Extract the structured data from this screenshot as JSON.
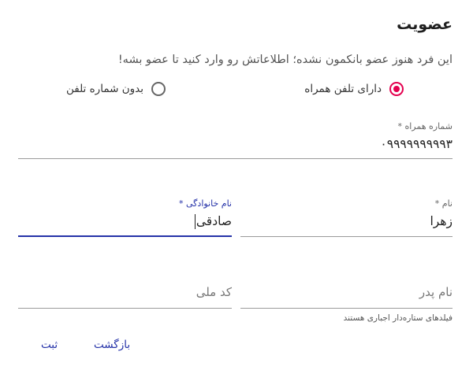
{
  "dialog": {
    "title": "عضویت",
    "intro": "این فرد هنوز عضو بانکمون نشده؛ اطلاعاتش رو وارد کنید تا عضو بشه!"
  },
  "phone_option": {
    "options": [
      {
        "label": "دارای تلفن همراه",
        "selected": true
      },
      {
        "label": "بدون شماره تلفن",
        "selected": false
      }
    ]
  },
  "form": {
    "mobile": {
      "label": "شماره همراه *",
      "value": "۰۹۹۹۹۹۹۹۹۹۳"
    },
    "first_name": {
      "label": "نام *",
      "value": "زهرا"
    },
    "last_name": {
      "label": "نام خانوادگی *",
      "value": "صادقی"
    },
    "father_name": {
      "placeholder": "نام پدر"
    },
    "national_code": {
      "placeholder": "کد ملی"
    },
    "required_hint": "فیلدهای ستاره‌دار اجباری هستند"
  },
  "actions": {
    "back_label": "بازگشت",
    "submit_label": "ثبت"
  },
  "colors": {
    "accent": "#e4004f",
    "primary": "#2532a8"
  }
}
